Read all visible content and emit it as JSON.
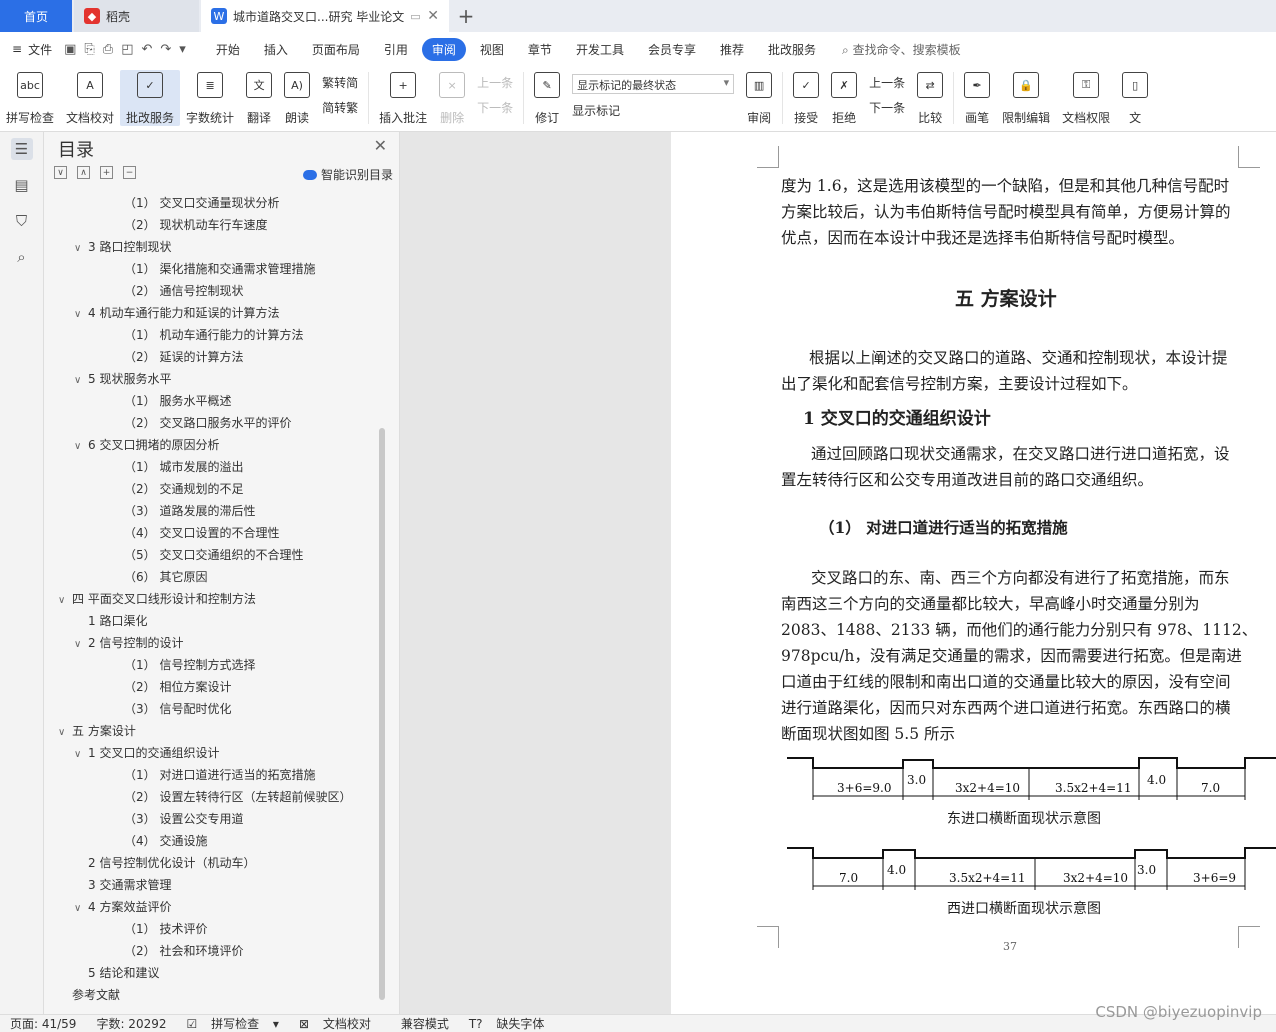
{
  "tabs": {
    "home": "首页",
    "daoke": "稻壳",
    "doc": "城市道路交叉口...研究 毕业论文",
    "add": "+"
  },
  "menu": {
    "file": "文件",
    "items": [
      "开始",
      "插入",
      "页面布局",
      "引用",
      "审阅",
      "视图",
      "章节",
      "开发工具",
      "会员专享",
      "推荐",
      "批改服务"
    ],
    "active": "审阅",
    "search": "查找命令、搜索模板"
  },
  "ribbon": {
    "spell": "拼写检查",
    "proof": "文档校对",
    "correct": "批改服务",
    "wordcount": "字数统计",
    "translate": "翻译",
    "read": "朗读",
    "trad": "繁转简",
    "simp": "简转繁",
    "insert_comment": "插入批注",
    "delete": "删除",
    "prev": "上一条",
    "next": "下一条",
    "revise": "修订",
    "markup_state": "显示标记的最终状态",
    "show_markup": "显示标记",
    "review": "审阅",
    "accept": "接受",
    "reject": "拒绝",
    "prev2": "上一条",
    "next2": "下一条",
    "compare": "比较",
    "pen": "画笔",
    "restrict": "限制编辑",
    "perm": "文档权限",
    "more": "文"
  },
  "toc": {
    "title": "目录",
    "smart": "智能识别目录",
    "items": [
      {
        "indent": 3,
        "text": "（1）  交叉口交通量现状分析",
        "chev": ""
      },
      {
        "indent": 3,
        "text": "（2）  现状机动车行车速度",
        "chev": ""
      },
      {
        "indent": 2,
        "text": "3  路口控制现状",
        "chev": "∨"
      },
      {
        "indent": 3,
        "text": "（1）  渠化措施和交通需求管理措施",
        "chev": ""
      },
      {
        "indent": 3,
        "text": "（2）  通信号控制现状",
        "chev": ""
      },
      {
        "indent": 2,
        "text": "4  机动车通行能力和延误的计算方法",
        "chev": "∨"
      },
      {
        "indent": 3,
        "text": "（1）  机动车通行能力的计算方法",
        "chev": ""
      },
      {
        "indent": 3,
        "text": "（2）  延误的计算方法",
        "chev": ""
      },
      {
        "indent": 2,
        "text": "5  现状服务水平",
        "chev": "∨"
      },
      {
        "indent": 3,
        "text": "（1）  服务水平概述",
        "chev": ""
      },
      {
        "indent": 3,
        "text": "（2）  交叉路口服务水平的评价",
        "chev": ""
      },
      {
        "indent": 2,
        "text": "6  交叉口拥堵的原因分析",
        "chev": "∨"
      },
      {
        "indent": 3,
        "text": "（1）  城市发展的溢出",
        "chev": ""
      },
      {
        "indent": 3,
        "text": "（2）  交通规划的不足",
        "chev": ""
      },
      {
        "indent": 3,
        "text": "（3）  道路发展的滞后性",
        "chev": ""
      },
      {
        "indent": 3,
        "text": "（4）  交叉口设置的不合理性",
        "chev": ""
      },
      {
        "indent": 3,
        "text": "（5）  交叉口交通组织的不合理性",
        "chev": ""
      },
      {
        "indent": 3,
        "text": "（6）  其它原因",
        "chev": ""
      },
      {
        "indent": 1,
        "text": "四  平面交叉口线形设计和控制方法",
        "chev": "∨"
      },
      {
        "indent": 2,
        "text": "1  路口渠化",
        "chev": ""
      },
      {
        "indent": 2,
        "text": "2  信号控制的设计",
        "chev": "∨"
      },
      {
        "indent": 3,
        "text": "（1）  信号控制方式选择",
        "chev": ""
      },
      {
        "indent": 3,
        "text": "（2）  相位方案设计",
        "chev": ""
      },
      {
        "indent": 3,
        "text": "（3）  信号配时优化",
        "chev": ""
      },
      {
        "indent": 1,
        "text": "五  方案设计",
        "chev": "∨"
      },
      {
        "indent": 2,
        "text": "1  交叉口的交通组织设计",
        "chev": "∨"
      },
      {
        "indent": 3,
        "text": "（1）  对进口道进行适当的拓宽措施",
        "chev": ""
      },
      {
        "indent": 3,
        "text": "（2）  设置左转待行区（左转超前候驶区）",
        "chev": ""
      },
      {
        "indent": 3,
        "text": "（3）  设置公交专用道",
        "chev": ""
      },
      {
        "indent": 3,
        "text": "（4）  交通设施",
        "chev": ""
      },
      {
        "indent": 2,
        "text": "2  信号控制优化设计（机动车）",
        "chev": ""
      },
      {
        "indent": 2,
        "text": "3  交通需求管理",
        "chev": ""
      },
      {
        "indent": 2,
        "text": "4  方案效益评价",
        "chev": "∨"
      },
      {
        "indent": 3,
        "text": "（1）  技术评价",
        "chev": ""
      },
      {
        "indent": 3,
        "text": "（2）  社会和环境评价",
        "chev": ""
      },
      {
        "indent": 2,
        "text": "5  结论和建议",
        "chev": ""
      },
      {
        "indent": 1,
        "text": "参考文献",
        "chev": ""
      }
    ]
  },
  "doc": {
    "para1": [
      "度为 1.6，这是选用该模型的一个缺陷，但是和其他几种信号配时",
      "方案比较后，认为韦伯斯特信号配时模型具有简单，方便易计算的",
      "优点，因而在本设计中我还是选择韦伯斯特信号配时模型。"
    ],
    "chapter": "五  方案设计",
    "para2": [
      "根据以上阐述的交叉路口的道路、交通和控制现状，本设计提",
      "出了渠化和配套信号控制方案，主要设计过程如下。"
    ],
    "section1": "1  交叉口的交通组织设计",
    "para3": [
      "通过回顾路口现状交通需求，在交叉路口进行进口道拓宽，设",
      "置左转待行区和公交专用道改进目前的路口交通组织。"
    ],
    "sub1": "（1）  对进口道进行适当的拓宽措施",
    "para4": [
      "交叉路口的东、南、西三个方向都没有进行了拓宽措施，而东",
      "南西这三个方向的交通量都比较大，早高峰小时交通量分别为",
      "2083、1488、2133 辆，而他们的通行能力分别只有 978、1112、",
      "978pcu/h，没有满足交通量的需求，因而需要进行拓宽。但是南进",
      "口道由于红线的限制和南出口道的交通量比较大的原因，没有空间",
      "进行道路渠化，因而只对东西两个进口道进行拓宽。东西路口的横",
      "断面现状图如图 5.5 所示"
    ],
    "fig1_labels": [
      "3+6=9.0",
      "3.0",
      "3x2+4=10",
      "3.5x2+4=11",
      "4.0",
      "7.0"
    ],
    "fig1_caption": "东进口横断面现状示意图",
    "fig2_labels": [
      "7.0",
      "4.0",
      "3.5x2+4=11",
      "3x2+4=10",
      "3.0",
      "3+6=9"
    ],
    "fig2_caption": "西进口横断面现状示意图",
    "page_number": "37"
  },
  "status": {
    "page": "页面: 41/59",
    "words": "字数: 20292",
    "spell": "拼写检查",
    "proof": "文档校对",
    "compat": "兼容模式",
    "missing_font": "缺失字体"
  },
  "watermark": "CSDN @biyezuopinvip"
}
